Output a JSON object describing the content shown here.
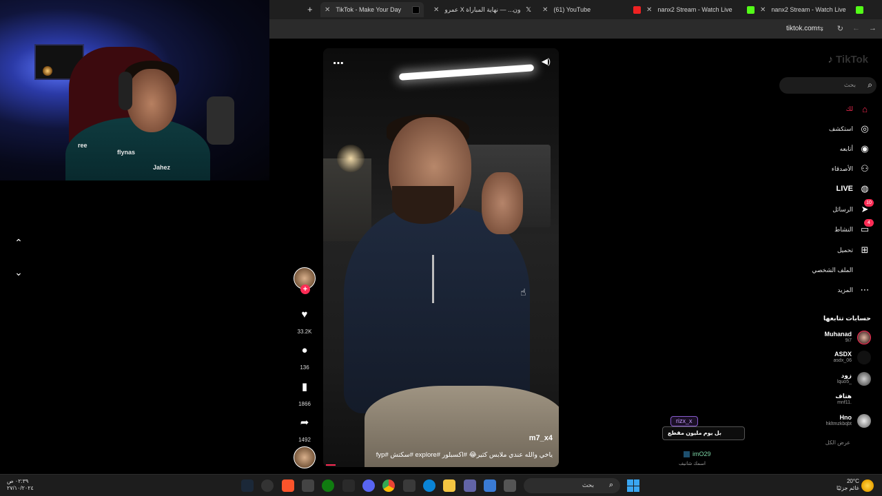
{
  "browser": {
    "tabs": [
      {
        "title": "TikTok - Make Your Day",
        "active": true
      },
      {
        "title": "عمرو X ون... — نهاية المباراة",
        "active": false
      },
      {
        "title": "(61) YouTube",
        "active": false
      },
      {
        "title": "nanx2 Stream - Watch Live",
        "active": false
      },
      {
        "title": "nanx2 Stream - Watch Live",
        "active": false
      }
    ],
    "url": "tiktok.com"
  },
  "brand": {
    "name": "TikTok"
  },
  "search": {
    "placeholder": "بحث"
  },
  "sidebar": {
    "items": [
      {
        "label": "لك",
        "icon": "home-icon",
        "active": true
      },
      {
        "label": "استكشف",
        "icon": "compass-icon"
      },
      {
        "label": "أتابعه",
        "icon": "following-icon"
      },
      {
        "label": "الأصدقاء",
        "icon": "friends-icon"
      },
      {
        "label": "LIVE",
        "icon": "live-icon"
      },
      {
        "label": "الرسائل",
        "icon": "messages-icon",
        "badge": "10"
      },
      {
        "label": "النشاط",
        "icon": "activity-icon",
        "badge": "4"
      },
      {
        "label": "تحميل",
        "icon": "upload-icon"
      },
      {
        "label": "الملف الشخصي",
        "icon": "profile-icon"
      },
      {
        "label": "المزيد",
        "icon": "more-icon"
      }
    ],
    "following_title": "حسابات تتابعها",
    "following": [
      {
        "name": "Muhanad",
        "handle": "9i7"
      },
      {
        "name": "ASDX",
        "handle": "asdx_06"
      },
      {
        "name": "زود",
        "handle": "lquo5_"
      },
      {
        "name": "هتاف",
        "handle": "mnf11."
      },
      {
        "name": "Hno",
        "handle": "hkltmzkbqbt"
      }
    ],
    "see_more": "عرض الكل"
  },
  "video": {
    "username": "m7_x4",
    "caption": "ياخي والله عندي ملابس كثير😂 #اكسبلور #explore #سكتش #fyp",
    "likes": "33.2K",
    "comments": "136",
    "saves": "1866",
    "shares": "1492"
  },
  "chat": [
    {
      "user": "rizx_x",
      "text": "بل يوم مليون مقطع"
    },
    {
      "user": "imO29",
      "text": "اسمك شانيف"
    }
  ],
  "taskbar": {
    "search_placeholder": "بحث",
    "time": "٠٢:٣٩ ص",
    "date": "٢٧/١٠/٢٠٢٤",
    "temperature": "20°C",
    "weather": "غائم جزئيًا"
  },
  "colors": {
    "accent": "#fe2c55",
    "chat_user": "#8a5cd1"
  }
}
